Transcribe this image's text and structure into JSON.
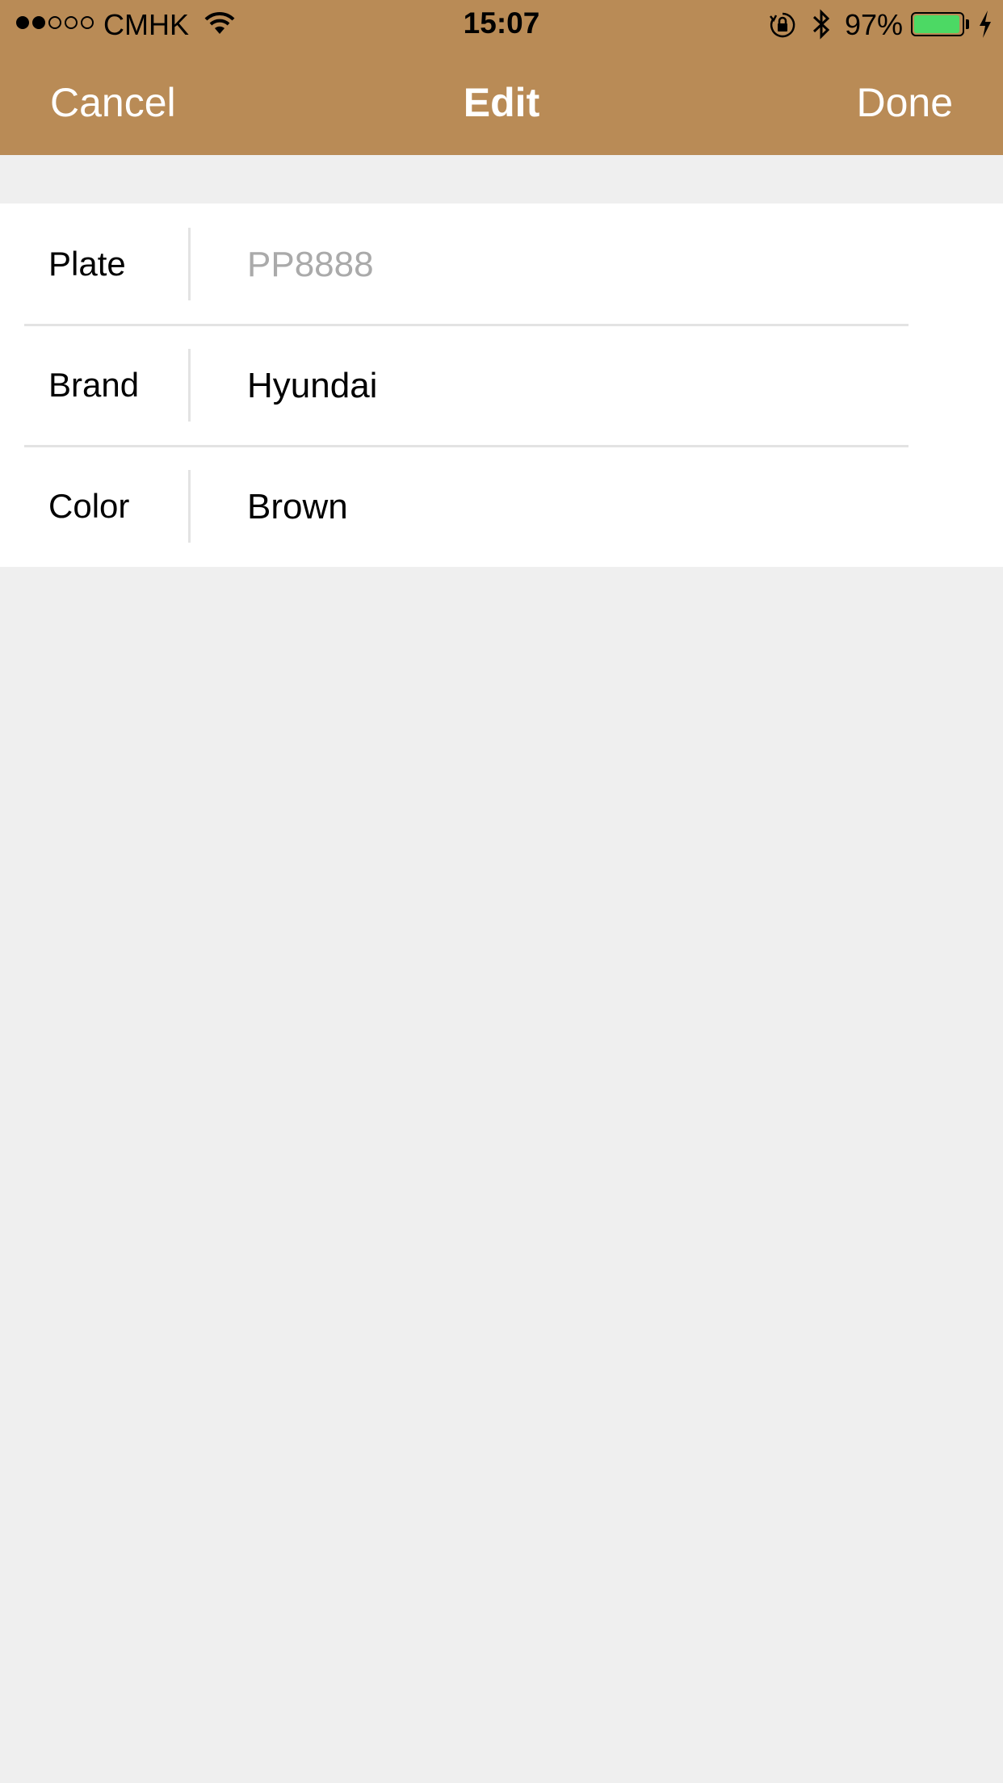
{
  "colors": {
    "nav_background": "#b98b56",
    "page_background": "#efefef",
    "battery_fill": "#4cd964"
  },
  "status_bar": {
    "carrier": "CMHK",
    "time": "15:07",
    "battery_percent": "97%",
    "battery_level": 0.97,
    "signal_strength": 2,
    "signal_max": 5,
    "icons": [
      "wifi-icon",
      "rotation-lock-icon",
      "bluetooth-icon",
      "battery-icon",
      "charging-bolt-icon"
    ]
  },
  "nav": {
    "left_label": "Cancel",
    "title": "Edit",
    "right_label": "Done"
  },
  "form": {
    "fields": [
      {
        "label": "Plate",
        "value": "",
        "placeholder": "PP8888"
      },
      {
        "label": "Brand",
        "value": "Hyundai",
        "placeholder": ""
      },
      {
        "label": "Color",
        "value": "Brown",
        "placeholder": ""
      }
    ]
  }
}
